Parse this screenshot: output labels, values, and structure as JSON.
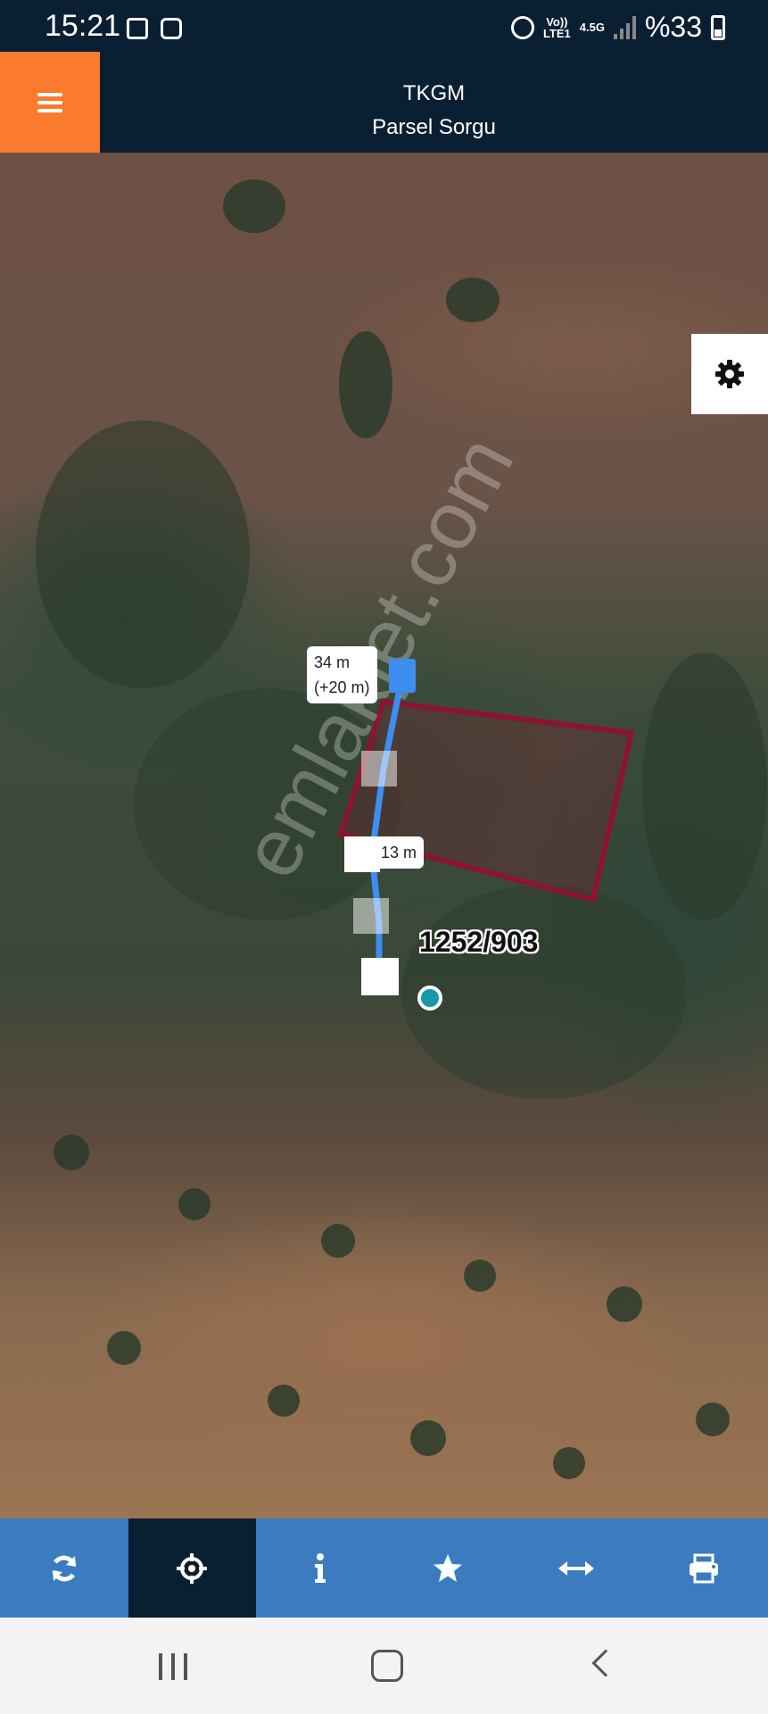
{
  "status_bar": {
    "time": "15:21",
    "network_volte": "Vo))",
    "network_lte": "LTE1",
    "network_type": "4.5G",
    "battery": "%33",
    "icons": [
      "gallery-icon",
      "notification-app-icon",
      "alarm-icon",
      "signal-icon",
      "battery-icon"
    ]
  },
  "header": {
    "title": "TKGM",
    "subtitle": "Parsel Sorgu",
    "menu_icon": "hamburger-menu-icon",
    "accent_color": "#fa7b2e",
    "bg_color": "#0b1f33"
  },
  "map": {
    "parcel_label": "1252/903",
    "parcel_color": "#8b1530",
    "measure_total": "34 m",
    "measure_extra": "(+20 m)",
    "measure_segment": "13 m",
    "measure_line_color": "#3d8ef0",
    "location_dot_color": "#1797a8",
    "watermark": "emlakjet.com",
    "settings_icon": "gear-icon"
  },
  "toolbar": {
    "bg_color": "#3b7cc0",
    "active_color": "#0b1f33",
    "items": [
      {
        "icon": "refresh-icon",
        "name": "refresh"
      },
      {
        "icon": "crosshair-icon",
        "name": "locate",
        "active": true
      },
      {
        "icon": "info-icon",
        "name": "info"
      },
      {
        "icon": "star-icon",
        "name": "favorites"
      },
      {
        "icon": "measure-arrows-icon",
        "name": "measure"
      },
      {
        "icon": "printer-icon",
        "name": "print"
      }
    ]
  },
  "nav_bar": {
    "icons": [
      "recent-apps-icon",
      "home-icon",
      "back-icon"
    ]
  }
}
